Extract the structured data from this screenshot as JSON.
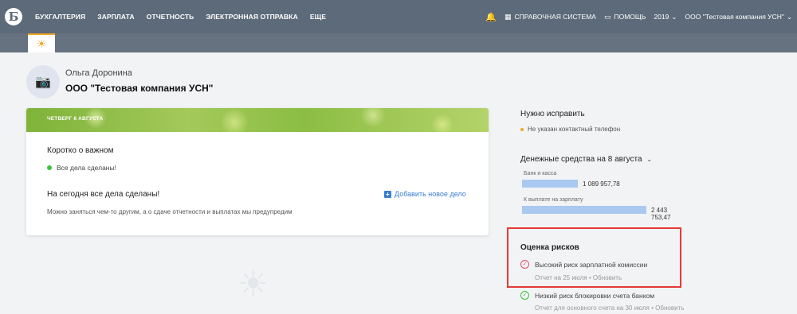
{
  "topbar": {
    "logo": "Б",
    "nav": [
      "БУХГАЛТЕРИЯ",
      "ЗАРПЛАТА",
      "ОТЧЕТНОСТЬ",
      "ЭЛЕКТРОННАЯ ОТПРАВКА",
      "ЕЩЕ"
    ],
    "help_system": "СПРАВОЧНАЯ СИСТЕМА",
    "help": "ПОМОЩЬ",
    "year": "2019",
    "company": "ООО \"Тестовая компания УСН\""
  },
  "profile": {
    "user_name": "Ольга Доронина",
    "company": "ООО \"Тестовая компания УСН\""
  },
  "main_card": {
    "date": "ЧЕТВЕРГ 8 АВГУСТА",
    "brief_title": "Коротко о важном",
    "brief_status": "Все дела сделаны!",
    "today_title": "На сегодня все дела сделаны!",
    "today_desc": "Можно заняться чем-то другим, а о сдаче отчетности и выплатах мы предупредим",
    "add_task": "Добавить новое дело"
  },
  "right": {
    "fix_title": "Нужно исправить",
    "fix_item": "Не указан контактный телефон",
    "money_title": "Денежные средства на 8 августа",
    "money": [
      {
        "label": "Банк и касса",
        "value": "1 089 957,78",
        "fraction": 0.446
      },
      {
        "label": "К выплате на зарплату",
        "value": "2 443 753,47",
        "fraction": 1.0
      }
    ],
    "risk_title": "Оценка рисков",
    "risks": [
      {
        "label": "Высокий риск зарплатной комиссии",
        "report": "Отчет на 25 июля",
        "action": "Обновить",
        "status": "high"
      },
      {
        "label": "Низкий риск блокировки счета банком",
        "report": "Отчет для основного счета на 30 июля",
        "action": "Обновить",
        "status": "low"
      }
    ]
  },
  "colors": {
    "topbar": "#5c6a79",
    "accent_blue": "#3a7fd0",
    "risk_highlight": "#e53935"
  }
}
